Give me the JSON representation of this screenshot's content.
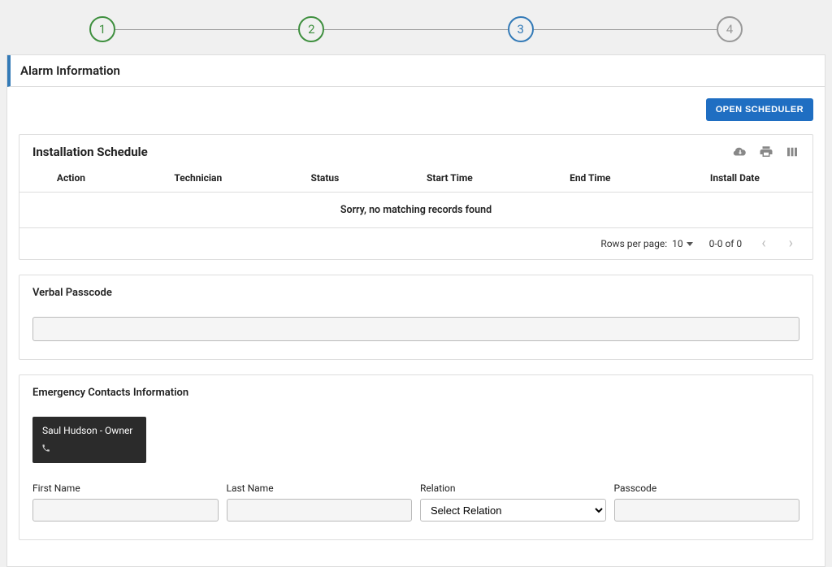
{
  "stepper": {
    "steps": [
      "1",
      "2",
      "3",
      "4"
    ],
    "activeIndex": 2
  },
  "page": {
    "title": "Alarm Information"
  },
  "actions": {
    "open_scheduler": "OPEN SCHEDULER"
  },
  "schedule": {
    "title": "Installation Schedule",
    "columns": [
      "Action",
      "Technician",
      "Status",
      "Start Time",
      "End Time",
      "Install Date"
    ],
    "empty_message": "Sorry, no matching records found",
    "pagination": {
      "rows_label": "Rows per page:",
      "rows_value": "10",
      "range": "0-0 of 0"
    }
  },
  "verbal_passcode": {
    "title": "Verbal Passcode",
    "value": ""
  },
  "emergency": {
    "title": "Emergency Contacts Information",
    "chip": {
      "name": "Saul Hudson - Owner"
    },
    "fields": {
      "first_name_label": "First Name",
      "first_name_value": "",
      "last_name_label": "Last Name",
      "last_name_value": "",
      "relation_label": "Relation",
      "relation_placeholder": "Select Relation",
      "passcode_label": "Passcode",
      "passcode_value": ""
    }
  }
}
